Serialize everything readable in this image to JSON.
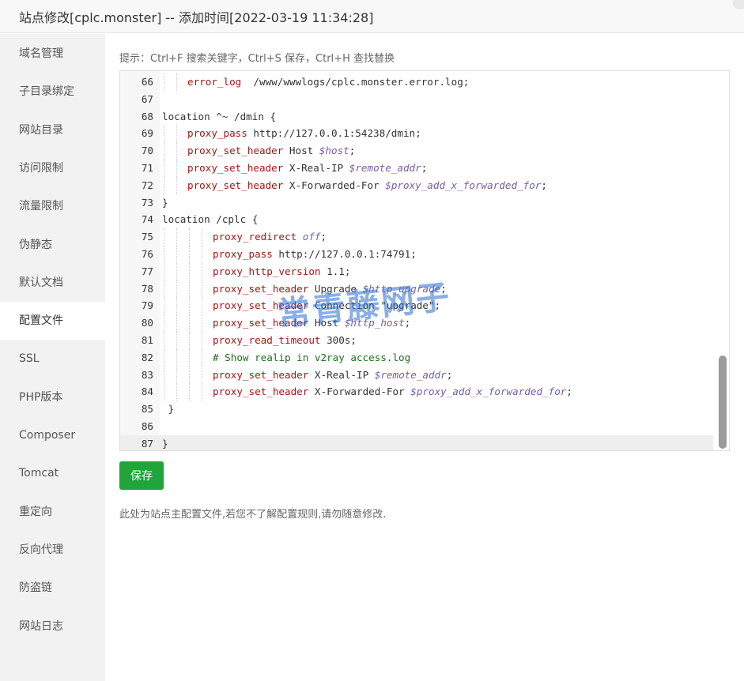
{
  "window": {
    "title": "站点修改[cplc.monster] -- 添加时间[2022-03-19 11:34:28]"
  },
  "sidebar": {
    "items": [
      {
        "label": "域名管理"
      },
      {
        "label": "子目录绑定"
      },
      {
        "label": "网站目录"
      },
      {
        "label": "访问限制"
      },
      {
        "label": "流量限制"
      },
      {
        "label": "伪静态"
      },
      {
        "label": "默认文档"
      },
      {
        "label": "配置文件",
        "active": true
      },
      {
        "label": "SSL"
      },
      {
        "label": "PHP版本"
      },
      {
        "label": "Composer"
      },
      {
        "label": "Tomcat"
      },
      {
        "label": "重定向"
      },
      {
        "label": "反向代理"
      },
      {
        "label": "防盗链"
      },
      {
        "label": "网站日志"
      }
    ]
  },
  "main": {
    "hint": "提示：Ctrl+F 搜索关键字，Ctrl+S 保存，Ctrl+H 查找替换",
    "save_label": "保存",
    "note": "此处为站点主配置文件,若您不了解配置规则,请勿随意修改."
  },
  "editor": {
    "current_line": 87,
    "lines": [
      {
        "n": "66",
        "indent": 1,
        "text": "error_log  /www/wwwlogs/cplc.monster.error.log;"
      },
      {
        "n": "67",
        "indent": 0,
        "text": ""
      },
      {
        "n": "68",
        "indent": 0,
        "text": "location ^~ /dmin {"
      },
      {
        "n": "69",
        "indent": 1,
        "text": "proxy_pass http://127.0.0.1:54238/dmin;"
      },
      {
        "n": "70",
        "indent": 1,
        "text": "proxy_set_header Host $host;"
      },
      {
        "n": "71",
        "indent": 1,
        "text": "proxy_set_header X-Real-IP $remote_addr;"
      },
      {
        "n": "72",
        "indent": 1,
        "text": "proxy_set_header X-Forwarded-For $proxy_add_x_forwarded_for;"
      },
      {
        "n": "73",
        "indent": 0,
        "text": "}"
      },
      {
        "n": "74",
        "indent": 0,
        "text": "location /cplc {"
      },
      {
        "n": "75",
        "indent": 2,
        "text": "proxy_redirect off;"
      },
      {
        "n": "76",
        "indent": 2,
        "text": "proxy_pass http://127.0.0.1:74791;"
      },
      {
        "n": "77",
        "indent": 2,
        "text": "proxy_http_version 1.1;"
      },
      {
        "n": "78",
        "indent": 2,
        "text": "proxy_set_header Upgrade $http_upgrade;"
      },
      {
        "n": "79",
        "indent": 2,
        "text": "proxy_set_header Connection \"upgrade\";"
      },
      {
        "n": "80",
        "indent": 2,
        "text": "proxy_set_header Host $http_host;"
      },
      {
        "n": "81",
        "indent": 2,
        "text": "proxy_read_timeout 300s;"
      },
      {
        "n": "82",
        "indent": 2,
        "text": "# Show realip in v2ray access.log"
      },
      {
        "n": "83",
        "indent": 2,
        "text": "proxy_set_header X-Real-IP $remote_addr;"
      },
      {
        "n": "84",
        "indent": 2,
        "text": "proxy_set_header X-Forwarded-For $proxy_add_x_forwarded_for;"
      },
      {
        "n": "85",
        "indent": 0,
        "text": " }"
      },
      {
        "n": "86",
        "indent": 0,
        "text": ""
      },
      {
        "n": "87",
        "indent": 0,
        "text": "}"
      }
    ]
  },
  "watermark": "常青藤网子",
  "colors": {
    "accent": "#20a53a",
    "directive": "#a31515",
    "variable": "#795da3",
    "comment": "#1c6f1c"
  }
}
